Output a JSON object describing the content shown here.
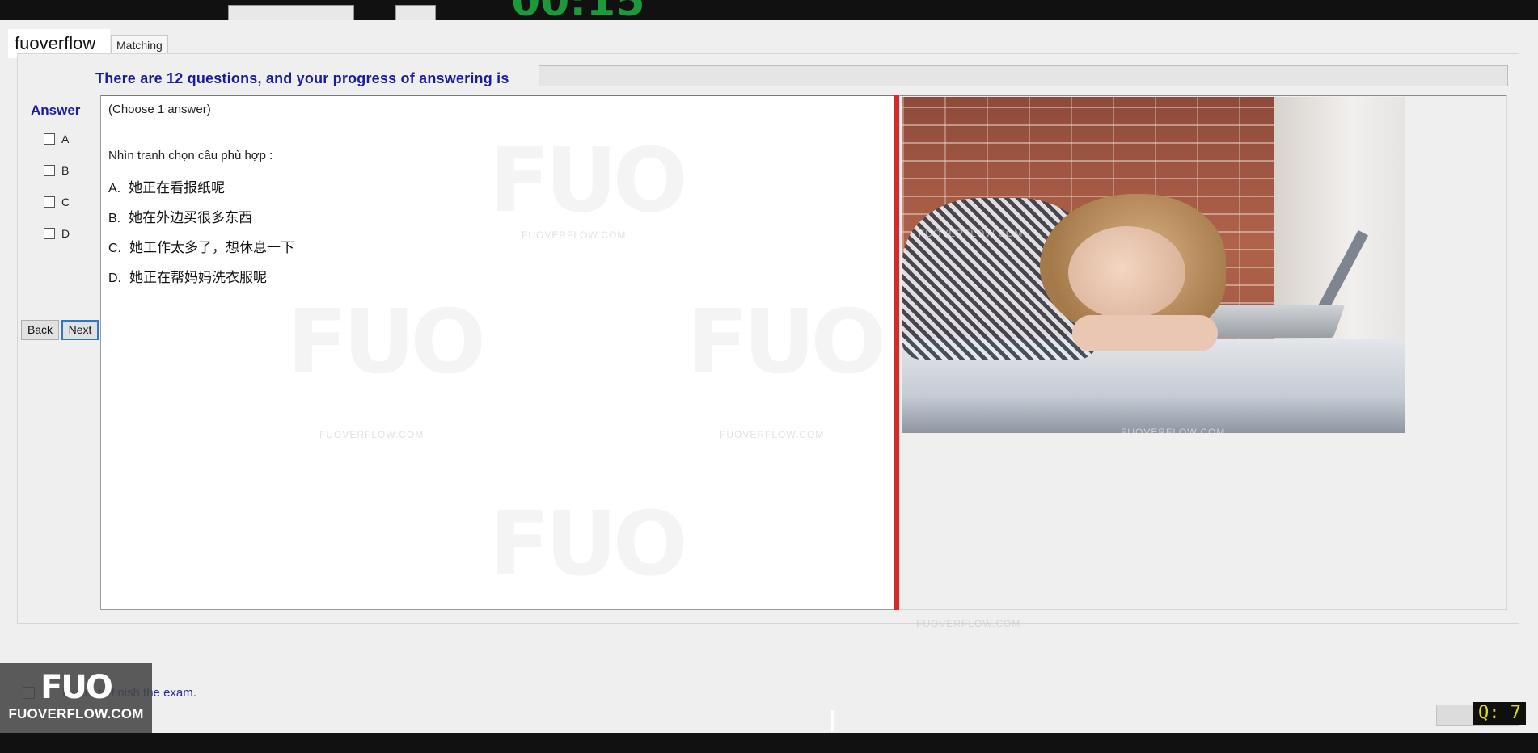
{
  "header": {
    "brand": "fuoverflow",
    "tab": "Matching"
  },
  "progress": {
    "label": "There are 12 questions, and your progress of answering is",
    "value_percent": 0
  },
  "answer_panel": {
    "title": "Answer",
    "options": [
      "A",
      "B",
      "C",
      "D"
    ],
    "back_label": "Back",
    "next_label": "Next"
  },
  "question": {
    "instruction": "(Choose 1 answer)",
    "prompt": "Nhìn tranh chọn câu phù hợp :",
    "options": [
      {
        "letter": "A.",
        "text": "她正在看报纸呢"
      },
      {
        "letter": "B.",
        "text": "她在外边买很多东西"
      },
      {
        "letter": "C.",
        "text": "她工作太多了，想休息一下"
      },
      {
        "letter": "D.",
        "text": "她正在帮妈妈洗衣服呢"
      }
    ]
  },
  "image": {
    "description": "woman-sleeping-on-desk-photo"
  },
  "watermark": {
    "logo_text": "FUO",
    "site_text": "FUOVERFLOW.COM"
  },
  "footer": {
    "finish_label": "I want to finish the exam.",
    "logo_big": "FUO",
    "logo_sub": "FUOVERFLOW.COM",
    "q_counter": "Q: 7"
  },
  "colors": {
    "accent_blue": "#1c1ca0",
    "divider_red": "#d42a2a",
    "timer_green": "#1c9a3a",
    "counter_yellow": "#e6e000"
  }
}
